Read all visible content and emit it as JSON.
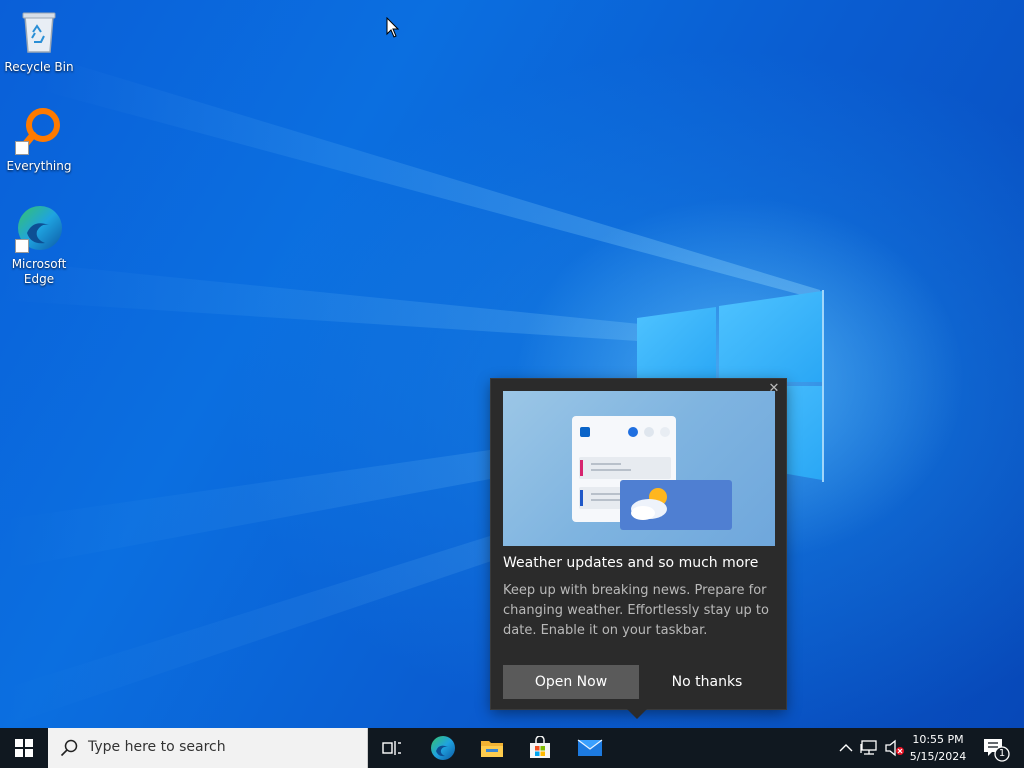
{
  "desktop": {
    "icons": [
      {
        "label": "Recycle Bin",
        "icon": "recycle-bin-icon"
      },
      {
        "label": "Everything",
        "icon": "everything-search-icon"
      },
      {
        "label": "Microsoft Edge",
        "icon": "edge-icon"
      }
    ]
  },
  "popup": {
    "title": "Weather updates and so much more",
    "body": "Keep up with breaking news. Prepare for changing weather. Effortlessly stay up to date. Enable it on your taskbar.",
    "open_label": "Open Now",
    "no_label": "No thanks",
    "close_glyph": "✕"
  },
  "taskbar": {
    "search_placeholder": "Type here to search",
    "apps": [
      "task-view",
      "microsoft-edge",
      "file-explorer",
      "microsoft-store",
      "mail"
    ],
    "time": "10:55 PM",
    "date": "5/15/2024",
    "notification_count": "1"
  },
  "colors": {
    "taskbar_bg": "#101820",
    "popup_bg": "#2b2b2b",
    "accent_blue": "#0a5fd8"
  }
}
